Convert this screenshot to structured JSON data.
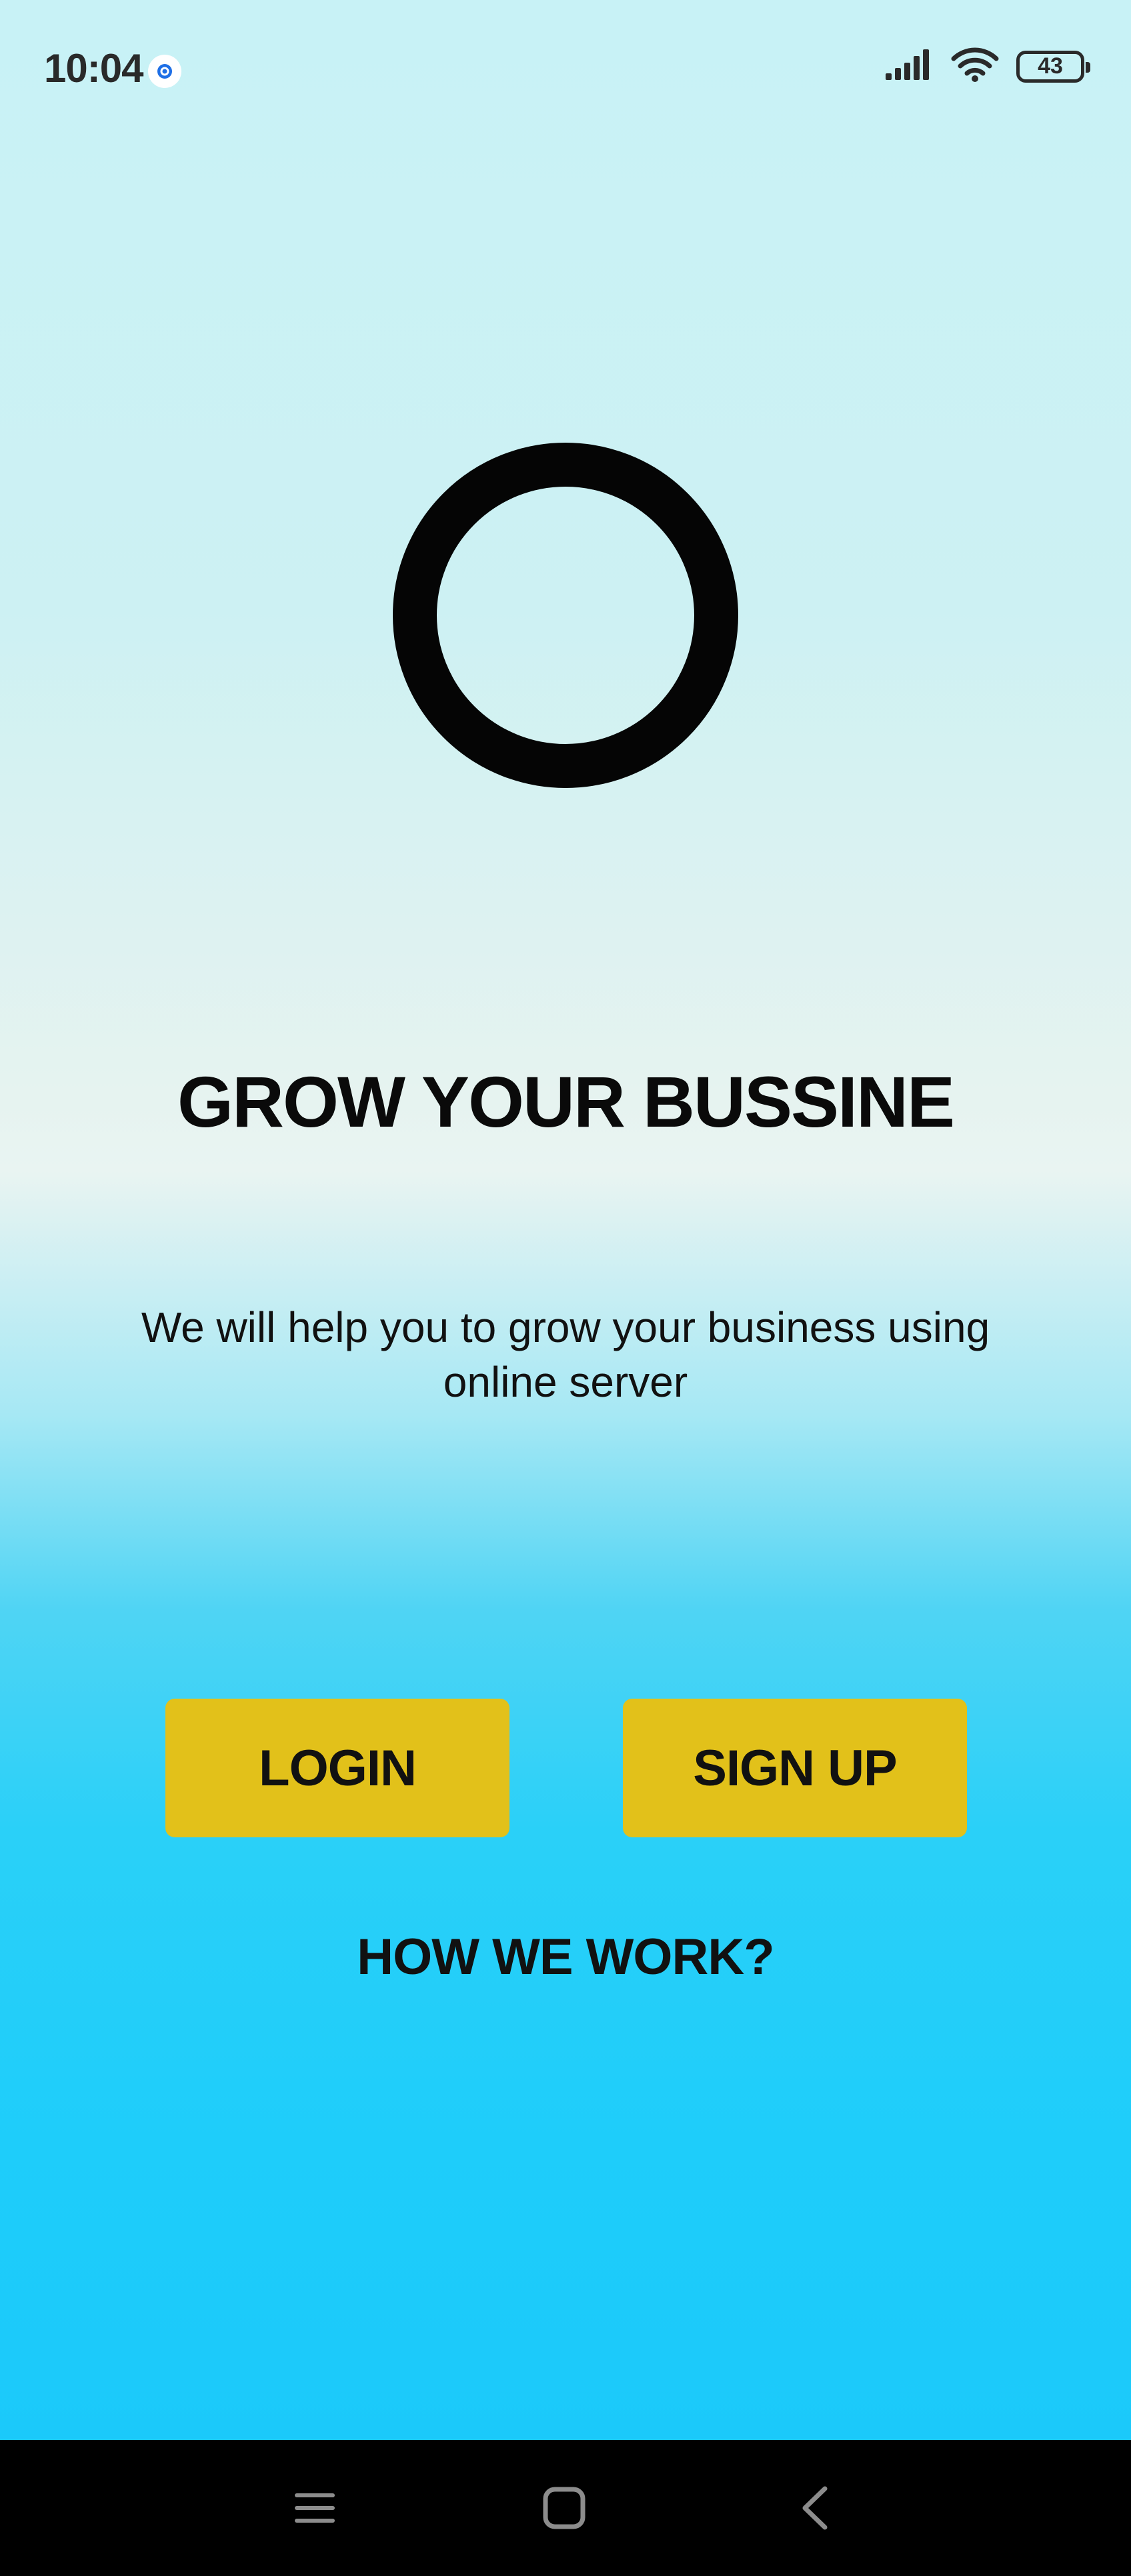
{
  "status_bar": {
    "time": "10:04",
    "app_icon": "app-notification-icon",
    "signal_icon": "cellular-signal-icon",
    "wifi_icon": "wifi-icon",
    "battery_level": "43"
  },
  "logo": {
    "icon": "ring-logo-icon"
  },
  "main": {
    "headline": "GROW YOUR BUSSINE",
    "subtitle": "We will help you to grow your business using online server",
    "login_label": "LOGIN",
    "signup_label": "SIGN UP",
    "how_we_work_label": "HOW WE WORK?"
  },
  "colors": {
    "button_bg": "#e2c11a",
    "background_top": "#c8f2f6",
    "background_bottom": "#1bc9fa",
    "navbar_bg": "#000000"
  },
  "nav_bar": {
    "menu_icon": "menu-icon",
    "home_icon": "home-square-icon",
    "back_icon": "back-chevron-icon"
  }
}
